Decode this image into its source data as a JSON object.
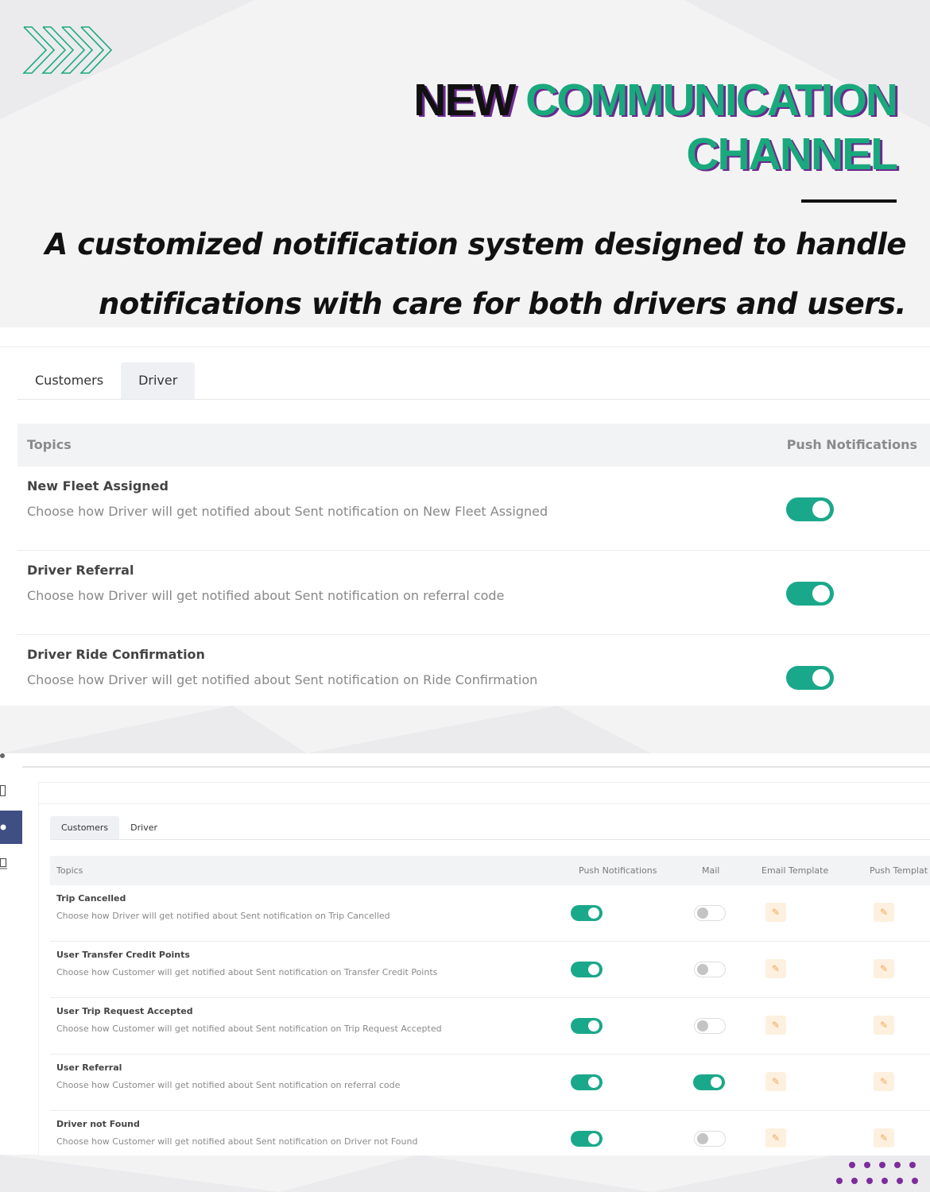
{
  "banner": {
    "title_dark": "NEW",
    "title_green_line1": "COMMUNICATION",
    "title_green_line2": "CHANNEL",
    "tagline_line1": "A customized notification system designed to handle",
    "tagline_line2": "notifications with care for both drivers and users."
  },
  "colors": {
    "accent_green": "#1aa88a",
    "title_green": "#1aa97c",
    "shadow_purple": "#6b2a8f",
    "edit_orange": "#f0a85a",
    "sidebar_active": "#3f4f84"
  },
  "panel_driver": {
    "tabs": [
      {
        "label": "Customers",
        "active": false
      },
      {
        "label": "Driver",
        "active": true
      }
    ],
    "columns": {
      "topics": "Topics",
      "push": "Push Notifications"
    },
    "rows": [
      {
        "title": "New Fleet Assigned",
        "desc": "Choose how Driver will get notified about Sent notification on New Fleet Assigned",
        "push": true
      },
      {
        "title": "Driver Referral",
        "desc": "Choose how Driver will get notified about Sent notification on referral code",
        "push": true
      },
      {
        "title": "Driver Ride Confirmation",
        "desc": "Choose how Driver will get notified about Sent notification on Ride Confirmation",
        "push": true
      }
    ]
  },
  "panel_customers": {
    "sidebar_icons": [
      "gear-icon",
      "tablet-icon",
      "settings-icon",
      "monitor-icon"
    ],
    "tabs": [
      {
        "label": "Customers",
        "active": true
      },
      {
        "label": "Driver",
        "active": false
      }
    ],
    "columns": {
      "topics": "Topics",
      "push": "Push Notifications",
      "mail": "Mail",
      "email_template": "Email Template",
      "push_template": "Push Templat"
    },
    "rows": [
      {
        "title": "Trip Cancelled",
        "desc": "Choose how Driver will get notified about Sent notification on Trip Cancelled",
        "push": true,
        "mail": false
      },
      {
        "title": "User Transfer Credit Points",
        "desc": "Choose how Customer will get notified about Sent notification on Transfer Credit Points",
        "push": true,
        "mail": false
      },
      {
        "title": "User Trip Request Accepted",
        "desc": "Choose how Customer will get notified about Sent notification on Trip Request Accepted",
        "push": true,
        "mail": false
      },
      {
        "title": "User Referral",
        "desc": "Choose how Customer will get notified about Sent notification on referral code",
        "push": true,
        "mail": true
      },
      {
        "title": "Driver not Found",
        "desc": "Choose how Customer will get notified about Sent notification on Driver not Found",
        "push": true,
        "mail": false
      }
    ]
  },
  "icons": {
    "chevrons": "chevrons-right-icon",
    "edit": "pencil-icon"
  }
}
